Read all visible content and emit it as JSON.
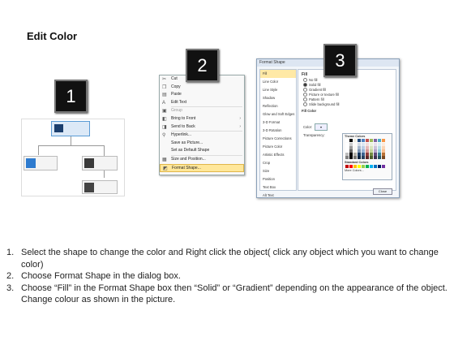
{
  "title": "Edit Color",
  "badges": [
    "1",
    "2",
    "3"
  ],
  "context_menu": {
    "items": [
      {
        "label": "Cut",
        "icon": "cut-icon"
      },
      {
        "label": "Copy",
        "icon": "copy-icon"
      },
      {
        "label": "Paste",
        "icon": "paste-icon"
      },
      {
        "label": "Edit Text",
        "icon": "edit-text-icon"
      },
      {
        "label": "Group",
        "icon": "group-icon",
        "disabled": true
      },
      {
        "label": "Bring to Front",
        "icon": "bring-front-icon",
        "submenu": true
      },
      {
        "label": "Send to Back",
        "icon": "send-back-icon",
        "submenu": true
      },
      {
        "label": "Hyperlink...",
        "icon": "hyperlink-icon"
      },
      {
        "label": "Save as Picture...",
        "icon": ""
      },
      {
        "label": "Set as Default Shape",
        "icon": ""
      },
      {
        "label": "Size and Position...",
        "icon": "size-position-icon"
      },
      {
        "label": "Format Shape...",
        "icon": "format-shape-icon",
        "highlighted": true
      }
    ]
  },
  "format_dialog": {
    "title": "Format Shape",
    "categories": [
      "Fill",
      "Line Color",
      "Line Style",
      "Shadow",
      "Reflection",
      "Glow and Soft Edges",
      "3-D Format",
      "3-D Rotation",
      "Picture Corrections",
      "Picture Color",
      "Artistic Effects",
      "Crop",
      "Size",
      "Position",
      "Text Box",
      "Alt Text"
    ],
    "fill_title": "Fill",
    "fill_options": [
      "No fill",
      "Solid fill",
      "Gradient fill",
      "Picture or texture fill",
      "Pattern fill",
      "Slide background fill"
    ],
    "fill_color_header": "Fill Color",
    "color_label": "Color:",
    "transparency_label": "Transparency:",
    "theme_colors_label": "Theme Colors",
    "standard_colors_label": "Standard Colors",
    "more_colors_label": "More Colors...",
    "close_label": "Close",
    "theme_colors": [
      "#ffffff",
      "#000000",
      "#eeece1",
      "#1f497d",
      "#4f81bd",
      "#c0504d",
      "#9bbb59",
      "#8064a2",
      "#4bacc6",
      "#f79646"
    ],
    "standard_colors": [
      "#c00000",
      "#ff0000",
      "#ffc000",
      "#ffff00",
      "#92d050",
      "#00b050",
      "#00b0f0",
      "#0070c0",
      "#002060",
      "#7030a0"
    ]
  },
  "instructions": [
    {
      "num": "1.",
      "text": "Select the shape to change the color and Right click the object( click any object which you want to change color)"
    },
    {
      "num": "2.",
      "text": "Choose Format Shape in the dialog box."
    },
    {
      "num": "3.",
      "text": "Choose “Fill” in the Format Shape box then “Solid” or “Gradient” depending on the appearance of the object. Change colour as shown in the picture."
    }
  ]
}
